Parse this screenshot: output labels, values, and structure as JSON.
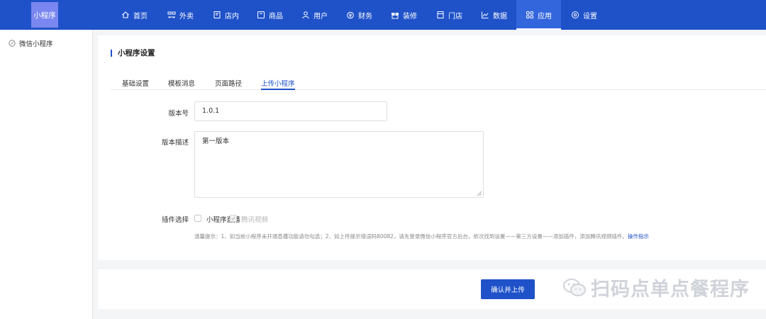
{
  "app": {
    "logo_text": "小程序"
  },
  "nav": {
    "items": [
      {
        "label": "首页",
        "icon": "home-icon"
      },
      {
        "label": "外卖",
        "icon": "delivery-icon"
      },
      {
        "label": "店内",
        "icon": "store-icon"
      },
      {
        "label": "商品",
        "icon": "product-icon"
      },
      {
        "label": "用户",
        "icon": "user-icon"
      },
      {
        "label": "财务",
        "icon": "finance-icon"
      },
      {
        "label": "装修",
        "icon": "decor-icon"
      },
      {
        "label": "门店",
        "icon": "shop-icon"
      },
      {
        "label": "数据",
        "icon": "chart-icon"
      },
      {
        "label": "应用",
        "icon": "apps-icon",
        "active": true
      },
      {
        "label": "设置",
        "icon": "gear-icon"
      }
    ]
  },
  "sidebar": {
    "items": [
      {
        "label": "微信小程序",
        "icon": "compass-icon"
      }
    ]
  },
  "page": {
    "title": "小程序设置",
    "tabs": [
      {
        "label": "基础设置"
      },
      {
        "label": "模板消息"
      },
      {
        "label": "页面路径"
      },
      {
        "label": "上传小程序",
        "active": true
      }
    ]
  },
  "form": {
    "version": {
      "label": "版本号",
      "value": "1.0.1"
    },
    "description": {
      "label": "版本描述",
      "value": "第一版本"
    },
    "plugins": {
      "label": "插件选择",
      "options": [
        {
          "label": "小程序直播",
          "checked": false,
          "disabled": false
        },
        {
          "label": "腾讯视频",
          "checked": true,
          "disabled": true
        }
      ]
    },
    "hint": {
      "text": "温馨提示：1、如当前小程序未开通直播功能请勿勾选；2、如上传提示错误码80082，请先登录微信小程序官方后台，依次找到设置——第三方设置——添加插件，添加腾讯视频插件。",
      "link": "操作指示"
    }
  },
  "footer": {
    "submit_label": "确认并上传"
  },
  "watermark": {
    "text": "扫码点单点餐程序",
    "icon": "wechat-icon"
  },
  "colors": {
    "primary": "#1f52c9",
    "active_nav": "#3366dd",
    "logo_bg": "#7a87f0"
  }
}
